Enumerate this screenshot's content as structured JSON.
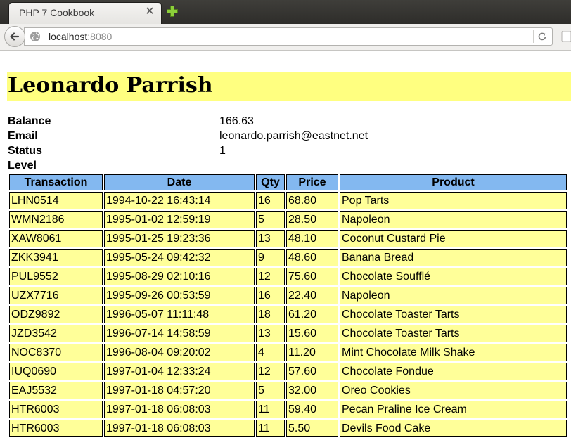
{
  "browser": {
    "tab_title": "PHP 7 Cookbook",
    "tab_close_glyph": "✕",
    "url_host": "localhost",
    "url_port": ":8080"
  },
  "customer": {
    "name": "Leonardo Parrish",
    "fields": [
      {
        "label": "Balance",
        "value": "166.63"
      },
      {
        "label": "Email",
        "value": "leonardo.parrish@eastnet.net"
      },
      {
        "label": "Status",
        "value": "1"
      },
      {
        "label": "Level",
        "value": ""
      }
    ]
  },
  "table": {
    "headers": [
      "Transaction",
      "Date",
      "Qty",
      "Price",
      "Product"
    ],
    "rows": [
      [
        "LHN0514",
        "1994-10-22 16:43:14",
        "16",
        "68.80",
        "Pop Tarts"
      ],
      [
        "WMN2186",
        "1995-01-02 12:59:19",
        "5",
        "28.50",
        "Napoleon"
      ],
      [
        "XAW8061",
        "1995-01-25 19:23:36",
        "13",
        "48.10",
        "Coconut Custard Pie"
      ],
      [
        "ZKK3941",
        "1995-05-24 09:42:32",
        "9",
        "48.60",
        "Banana Bread"
      ],
      [
        "PUL9552",
        "1995-08-29 02:10:16",
        "12",
        "75.60",
        "Chocolate Soufflé"
      ],
      [
        "UZX7716",
        "1995-09-26 00:53:59",
        "16",
        "22.40",
        "Napoleon"
      ],
      [
        "ODZ9892",
        "1996-05-07 11:11:48",
        "18",
        "61.20",
        "Chocolate Toaster Tarts"
      ],
      [
        "JZD3542",
        "1996-07-14 14:58:59",
        "13",
        "15.60",
        "Chocolate Toaster Tarts"
      ],
      [
        "NOC8370",
        "1996-08-04 09:20:02",
        "4",
        "11.20",
        "Mint Chocolate Milk Shake"
      ],
      [
        "IUQ0690",
        "1997-01-04 12:33:24",
        "12",
        "57.60",
        "Chocolate Fondue"
      ],
      [
        "EAJ5532",
        "1997-01-18 04:57:20",
        "5",
        "32.00",
        "Oreo Cookies"
      ],
      [
        "HTR6003",
        "1997-01-18 06:08:03",
        "11",
        "59.40",
        "Pecan Praline Ice Cream"
      ],
      [
        "HTR6003",
        "1997-01-18 06:08:03",
        "11",
        "5.50",
        "Devils Food Cake"
      ]
    ]
  },
  "colors": {
    "name_banner": "#ffff80",
    "table_header": "#83b8f0",
    "table_cell": "#ffff99",
    "new_tab_plus": "#8ccf3a"
  },
  "icons": {
    "new_tab": "plus-icon",
    "back": "back-arrow-icon",
    "site": "globe-icon",
    "reload": "reload-icon"
  }
}
